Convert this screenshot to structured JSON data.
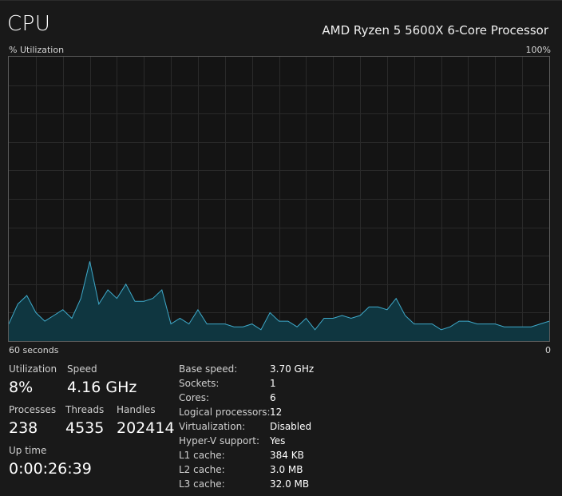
{
  "header": {
    "title": "CPU",
    "processor_name": "AMD Ryzen 5 5600X 6-Core Processor"
  },
  "graph": {
    "y_label": "% Utilization",
    "y_max_label": "100%",
    "x_left_label": "60 seconds",
    "x_right_label": "0",
    "line_color": "#3fa9c9",
    "fill_color": "#0f3640",
    "grid_color": "#2a2a2a"
  },
  "chart_data": {
    "type": "area",
    "ylim": [
      0,
      100
    ],
    "grid": true,
    "values": [
      6,
      13,
      16,
      10,
      7,
      9,
      11,
      8,
      15,
      28,
      13,
      18,
      15,
      20,
      14,
      14,
      15,
      18,
      6,
      8,
      6,
      11,
      6,
      6,
      6,
      5,
      5,
      6,
      4,
      10,
      7,
      7,
      5,
      8,
      4,
      8,
      8,
      9,
      8,
      9,
      12,
      12,
      11,
      15,
      9,
      6,
      6,
      6,
      4,
      5,
      7,
      7,
      6,
      6,
      6,
      5,
      5,
      5,
      5,
      6,
      7
    ]
  },
  "stats": {
    "utilization_label": "Utilization",
    "utilization_value": "8%",
    "speed_label": "Speed",
    "speed_value": "4.16 GHz",
    "processes_label": "Processes",
    "processes_value": "238",
    "threads_label": "Threads",
    "threads_value": "4535",
    "handles_label": "Handles",
    "handles_value": "202414",
    "uptime_label": "Up time",
    "uptime_value": "0:00:26:39"
  },
  "details": [
    {
      "key": "Base speed:",
      "value": "3.70 GHz"
    },
    {
      "key": "Sockets:",
      "value": "1"
    },
    {
      "key": "Cores:",
      "value": "6"
    },
    {
      "key": "Logical processors:",
      "value": "12"
    },
    {
      "key": "Virtualization:",
      "value": "Disabled"
    },
    {
      "key": "Hyper-V support:",
      "value": "Yes"
    },
    {
      "key": "L1 cache:",
      "value": "384 KB"
    },
    {
      "key": "L2 cache:",
      "value": "3.0 MB"
    },
    {
      "key": "L3 cache:",
      "value": "32.0 MB"
    }
  ]
}
